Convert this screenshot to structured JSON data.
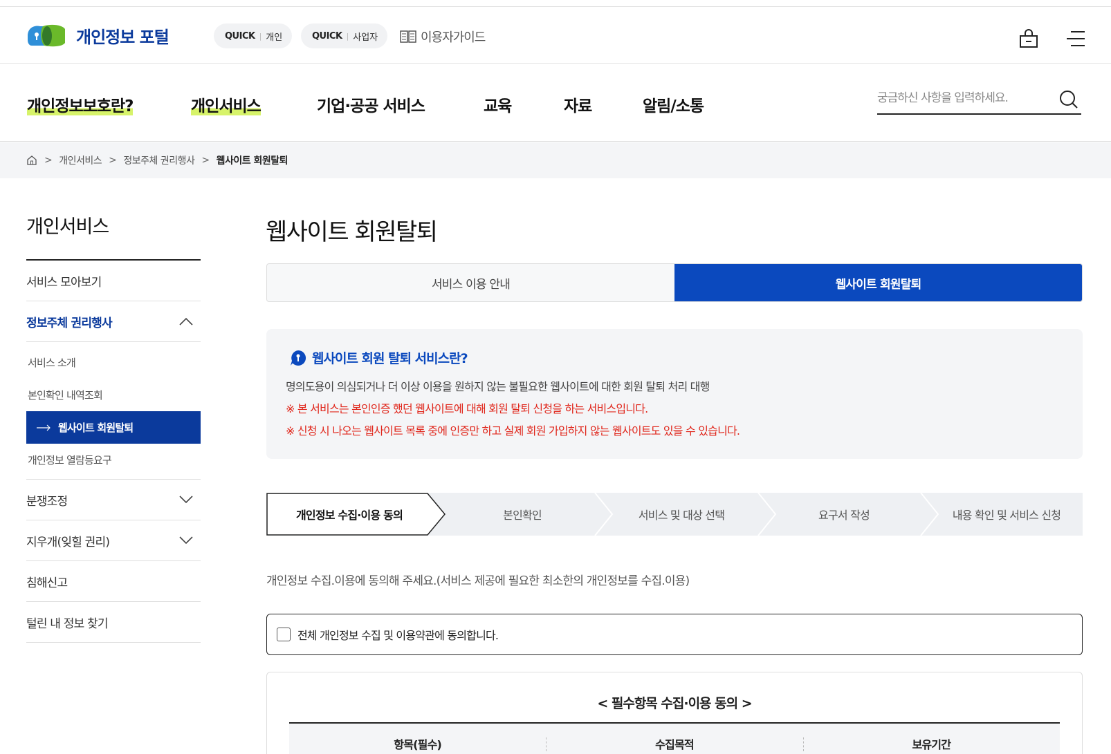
{
  "header": {
    "logo_text": "개인정보 포털",
    "quick1": {
      "q": "QUICK",
      "label": "개인"
    },
    "quick2": {
      "q": "QUICK",
      "label": "사업자"
    },
    "guide": "이용자가이드"
  },
  "nav": {
    "items": [
      "개인정보보호란?",
      "개인서비스",
      "기업·공공 서비스",
      "교육",
      "자료",
      "알림/소통"
    ],
    "search_placeholder": "궁금하신 사항을 입력하세요."
  },
  "breadcrumb": [
    "개인서비스",
    "정보주체 권리행사",
    "웹사이트 회원탈퇴"
  ],
  "sidebar": {
    "title": "개인서비스",
    "items": [
      "서비스 모아보기",
      "정보주체 권리행사",
      "분쟁조정",
      "지우개(잊힐 권리)",
      "침해신고",
      "털린 내 정보 찾기"
    ],
    "sub": [
      "서비스 소개",
      "본인확인 내역조회",
      "웹사이트 회원탈퇴",
      "개인정보 열람등요구"
    ]
  },
  "main": {
    "title": "웹사이트 회원탈퇴",
    "tabs": [
      "서비스 이용 안내",
      "웹사이트 회원탈퇴"
    ],
    "info": {
      "title": "웹사이트 회원 탈퇴 서비스란?",
      "line1": "명의도용이 의심되거나 더 이상 이용을 원하지 않는 불필요한 웹사이트에 대한 회원 탈퇴 처리 대행",
      "line2": "※ 본 서비스는 본인인증 했던 웹사이트에 대해 회원 탈퇴 신청을 하는 서비스입니다.",
      "line3": "※ 신청 시 나오는 웹사이트 목록 중에 인증만 하고 실제 회원 가입하지 않는 웹사이트도 있을 수 있습니다."
    },
    "steps": [
      "개인정보 수집·이용 동의",
      "본인확인",
      "서비스 및 대상 선택",
      "요구서 작성",
      "내용 확인 및 서비스 신청"
    ],
    "desc": "개인정보 수집.이용에 동의해 주세요.(서비스 제공에 필요한 최소한의 개인정보를 수집.이용)",
    "agree_all": "전체 개인정보 수집 및 이용약관에 동의합니다.",
    "table": {
      "title": "< 필수항목 수집·이용 동의 >",
      "headers": [
        "항목(필수)",
        "수집목적",
        "보유기간"
      ]
    }
  },
  "colors": {
    "brand": "#0b49be",
    "highlight": "#d7f36a",
    "warning": "#e0261b"
  }
}
